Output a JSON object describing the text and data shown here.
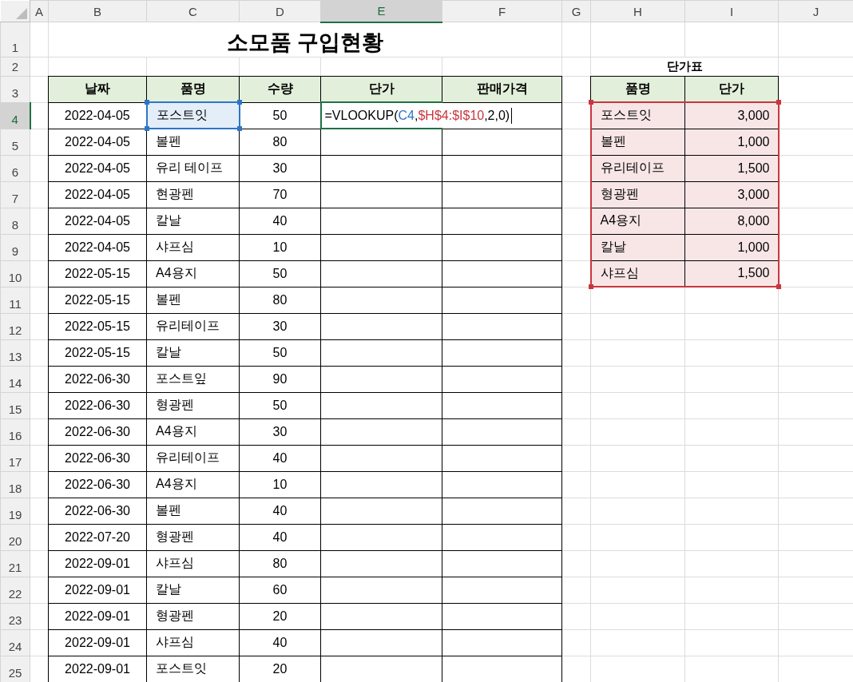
{
  "column_headers": [
    {
      "label": "A",
      "selected": false
    },
    {
      "label": "B",
      "selected": false
    },
    {
      "label": "C",
      "selected": false
    },
    {
      "label": "D",
      "selected": false
    },
    {
      "label": "E",
      "selected": true
    },
    {
      "label": "F",
      "selected": false
    },
    {
      "label": "G",
      "selected": false
    },
    {
      "label": "H",
      "selected": false
    },
    {
      "label": "I",
      "selected": false
    },
    {
      "label": "J",
      "selected": false
    }
  ],
  "row_headers": [
    {
      "label": "1",
      "selected": false
    },
    {
      "label": "2",
      "selected": false
    },
    {
      "label": "3",
      "selected": false
    },
    {
      "label": "4",
      "selected": true
    },
    {
      "label": "5",
      "selected": false
    },
    {
      "label": "6",
      "selected": false
    },
    {
      "label": "7",
      "selected": false
    },
    {
      "label": "8",
      "selected": false
    },
    {
      "label": "9",
      "selected": false
    },
    {
      "label": "10",
      "selected": false
    },
    {
      "label": "11",
      "selected": false
    },
    {
      "label": "12",
      "selected": false
    },
    {
      "label": "13",
      "selected": false
    },
    {
      "label": "14",
      "selected": false
    },
    {
      "label": "15",
      "selected": false
    },
    {
      "label": "16",
      "selected": false
    },
    {
      "label": "17",
      "selected": false
    },
    {
      "label": "18",
      "selected": false
    },
    {
      "label": "19",
      "selected": false
    },
    {
      "label": "20",
      "selected": false
    },
    {
      "label": "21",
      "selected": false
    },
    {
      "label": "22",
      "selected": false
    },
    {
      "label": "23",
      "selected": false
    },
    {
      "label": "24",
      "selected": false
    },
    {
      "label": "25",
      "selected": false
    }
  ],
  "title": "소모품 구입현황",
  "purchase_table": {
    "columns": [
      "날짜",
      "품명",
      "수량",
      "단가",
      "판매가격"
    ],
    "formula": [
      {
        "text": "=VLOOKUP("
      },
      {
        "text": "C4",
        "color": "#2e75c8"
      },
      {
        "text": ","
      },
      {
        "text": "$H$4:$I$10",
        "color": "#c8363e"
      },
      {
        "text": ",2,0)"
      }
    ],
    "rows": [
      {
        "date": "2022-04-05",
        "item": "포스트잇",
        "quantity": "50",
        "referenced": true
      },
      {
        "date": "2022-04-05",
        "item": "볼펜",
        "quantity": "80",
        "referenced": false
      },
      {
        "date": "2022-04-05",
        "item": "유리 테이프",
        "quantity": "30",
        "referenced": false
      },
      {
        "date": "2022-04-05",
        "item": "현광펜",
        "quantity": "70",
        "referenced": false
      },
      {
        "date": "2022-04-05",
        "item": "칼날",
        "quantity": "40",
        "referenced": false
      },
      {
        "date": "2022-04-05",
        "item": "샤프심",
        "quantity": "10",
        "referenced": false
      },
      {
        "date": "2022-05-15",
        "item": "A4용지",
        "quantity": "50",
        "referenced": false
      },
      {
        "date": "2022-05-15",
        "item": "볼펜",
        "quantity": "80",
        "referenced": false
      },
      {
        "date": "2022-05-15",
        "item": "유리테이프",
        "quantity": "30",
        "referenced": false
      },
      {
        "date": "2022-05-15",
        "item": "칼날",
        "quantity": "50",
        "referenced": false
      },
      {
        "date": "2022-06-30",
        "item": "포스트잎",
        "quantity": "90",
        "referenced": false
      },
      {
        "date": "2022-06-30",
        "item": "형광펜",
        "quantity": "50",
        "referenced": false
      },
      {
        "date": "2022-06-30",
        "item": "A4용지",
        "quantity": "30",
        "referenced": false
      },
      {
        "date": "2022-06-30",
        "item": "유리테이프",
        "quantity": "40",
        "referenced": false
      },
      {
        "date": "2022-06-30",
        "item": "A4용지",
        "quantity": "10",
        "referenced": false
      },
      {
        "date": "2022-06-30",
        "item": "볼펜",
        "quantity": "40",
        "referenced": false
      },
      {
        "date": "2022-07-20",
        "item": "형광펜",
        "quantity": "40",
        "referenced": false
      },
      {
        "date": "2022-09-01",
        "item": "샤프심",
        "quantity": "80",
        "referenced": false
      },
      {
        "date": "2022-09-01",
        "item": "칼날",
        "quantity": "60",
        "referenced": false
      },
      {
        "date": "2022-09-01",
        "item": "형광펜",
        "quantity": "20",
        "referenced": false
      },
      {
        "date": "2022-09-01",
        "item": "샤프심",
        "quantity": "40",
        "referenced": false
      },
      {
        "date": "2022-09-01",
        "item": "포스트잇",
        "quantity": "20",
        "referenced": false
      }
    ]
  },
  "price_table": {
    "title": "단가표",
    "columns": [
      "품명",
      "단가"
    ],
    "referenced": true,
    "rows": [
      {
        "item": "포스트잇",
        "price": "3,000"
      },
      {
        "item": "볼펜",
        "price": "1,000"
      },
      {
        "item": "유리테이프",
        "price": "1,500"
      },
      {
        "item": "형광펜",
        "price": "3,000"
      },
      {
        "item": "A4용지",
        "price": "8,000"
      },
      {
        "item": "칼날",
        "price": "1,000"
      },
      {
        "item": "샤프심",
        "price": "1,500"
      }
    ]
  }
}
